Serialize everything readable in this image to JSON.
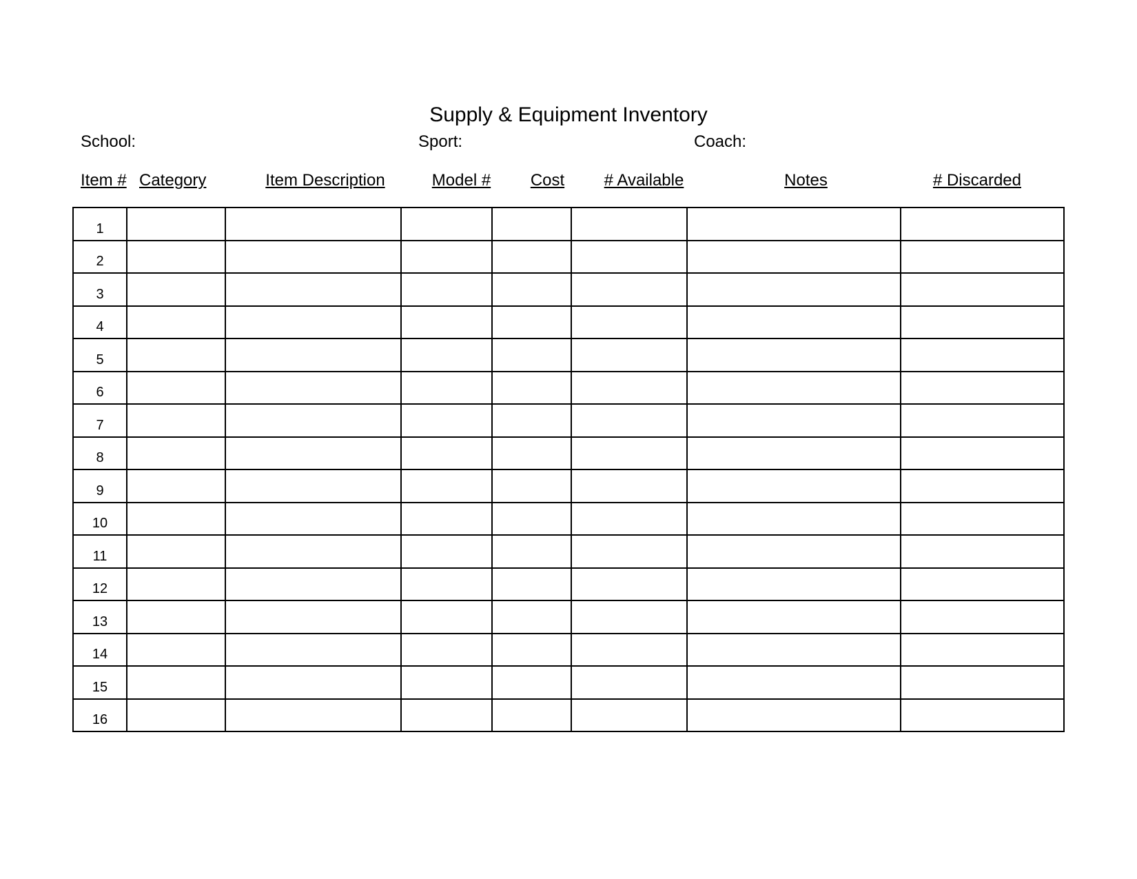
{
  "title": "Supply & Equipment Inventory",
  "meta": {
    "school_label": "School:",
    "sport_label": "Sport:",
    "coach_label": "Coach:",
    "school_value": "",
    "sport_value": "",
    "coach_value": ""
  },
  "columns": {
    "item_num": "Item #",
    "category": "Category",
    "description": "Item Description",
    "model": "Model #",
    "cost": "Cost",
    "available": "# Available",
    "notes": "Notes",
    "discarded": "# Discarded"
  },
  "rows": [
    {
      "item_num": "1",
      "category": "",
      "description": "",
      "model": "",
      "cost": "",
      "available": "",
      "notes": "",
      "discarded": ""
    },
    {
      "item_num": "2",
      "category": "",
      "description": "",
      "model": "",
      "cost": "",
      "available": "",
      "notes": "",
      "discarded": ""
    },
    {
      "item_num": "3",
      "category": "",
      "description": "",
      "model": "",
      "cost": "",
      "available": "",
      "notes": "",
      "discarded": ""
    },
    {
      "item_num": "4",
      "category": "",
      "description": "",
      "model": "",
      "cost": "",
      "available": "",
      "notes": "",
      "discarded": ""
    },
    {
      "item_num": "5",
      "category": "",
      "description": "",
      "model": "",
      "cost": "",
      "available": "",
      "notes": "",
      "discarded": ""
    },
    {
      "item_num": "6",
      "category": "",
      "description": "",
      "model": "",
      "cost": "",
      "available": "",
      "notes": "",
      "discarded": ""
    },
    {
      "item_num": "7",
      "category": "",
      "description": "",
      "model": "",
      "cost": "",
      "available": "",
      "notes": "",
      "discarded": ""
    },
    {
      "item_num": "8",
      "category": "",
      "description": "",
      "model": "",
      "cost": "",
      "available": "",
      "notes": "",
      "discarded": ""
    },
    {
      "item_num": "9",
      "category": "",
      "description": "",
      "model": "",
      "cost": "",
      "available": "",
      "notes": "",
      "discarded": ""
    },
    {
      "item_num": "10",
      "category": "",
      "description": "",
      "model": "",
      "cost": "",
      "available": "",
      "notes": "",
      "discarded": ""
    },
    {
      "item_num": "11",
      "category": "",
      "description": "",
      "model": "",
      "cost": "",
      "available": "",
      "notes": "",
      "discarded": ""
    },
    {
      "item_num": "12",
      "category": "",
      "description": "",
      "model": "",
      "cost": "",
      "available": "",
      "notes": "",
      "discarded": ""
    },
    {
      "item_num": "13",
      "category": "",
      "description": "",
      "model": "",
      "cost": "",
      "available": "",
      "notes": "",
      "discarded": ""
    },
    {
      "item_num": "14",
      "category": "",
      "description": "",
      "model": "",
      "cost": "",
      "available": "",
      "notes": "",
      "discarded": ""
    },
    {
      "item_num": "15",
      "category": "",
      "description": "",
      "model": "",
      "cost": "",
      "available": "",
      "notes": "",
      "discarded": ""
    },
    {
      "item_num": "16",
      "category": "",
      "description": "",
      "model": "",
      "cost": "",
      "available": "",
      "notes": "",
      "discarded": ""
    }
  ]
}
